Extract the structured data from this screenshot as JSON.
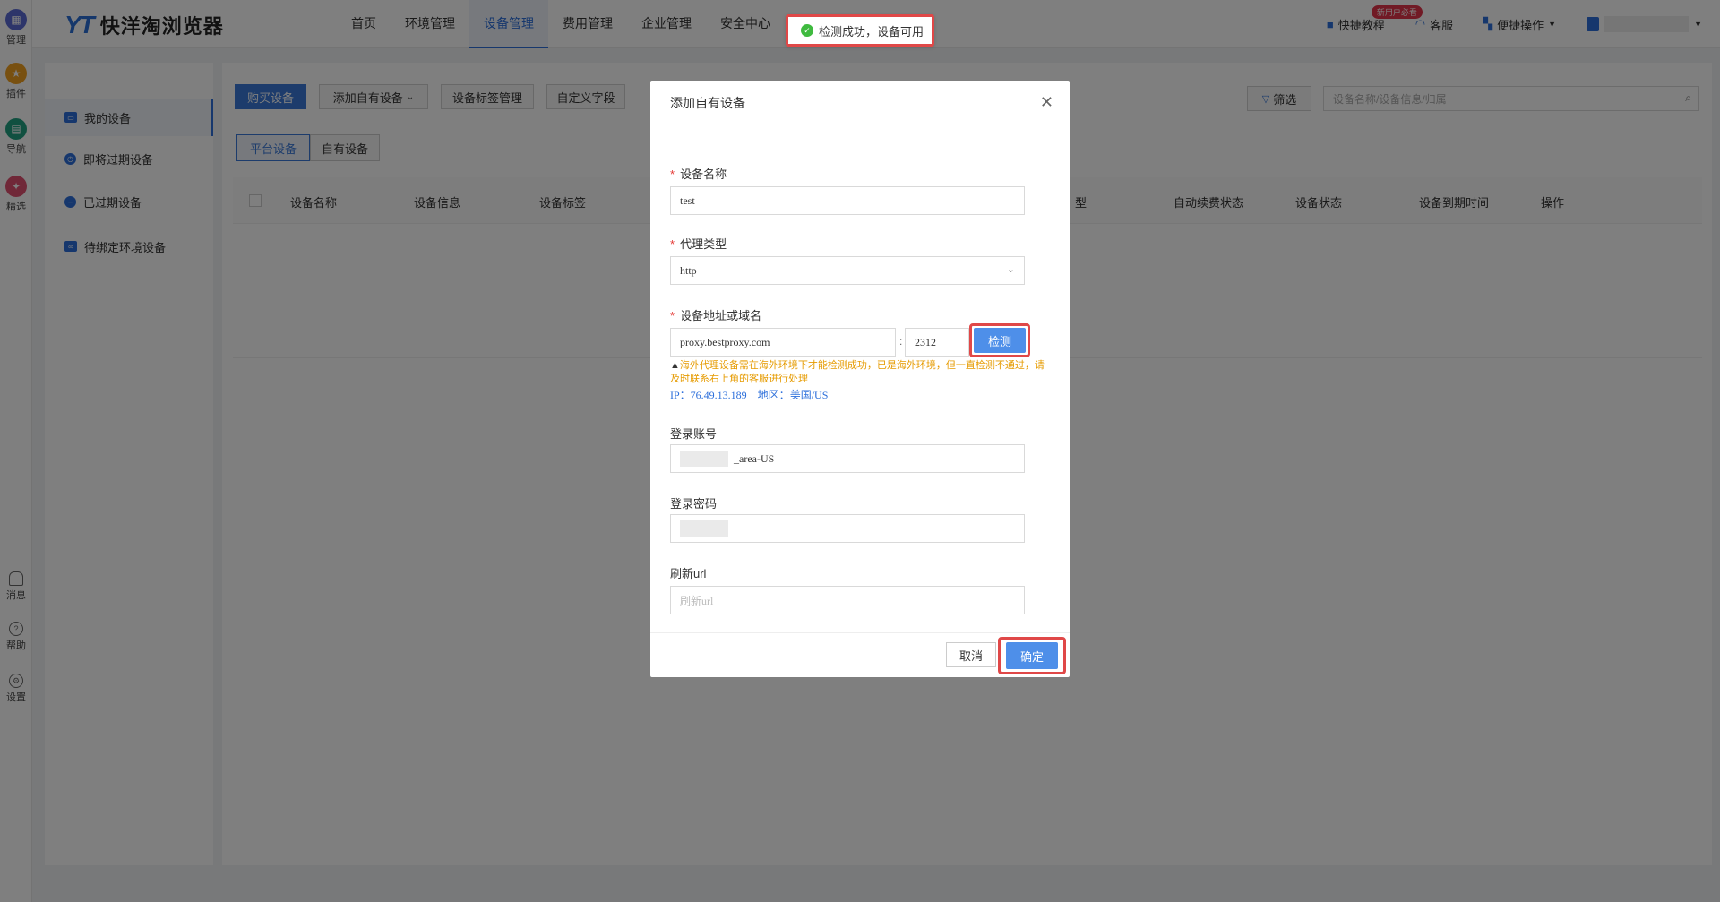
{
  "rail": {
    "items": [
      {
        "label": "管理",
        "icon": "grid-icon",
        "color": "#5b6bd4"
      },
      {
        "label": "插件",
        "icon": "star-icon",
        "color": "#f0a020"
      },
      {
        "label": "导航",
        "icon": "nav-icon",
        "color": "#20a080"
      },
      {
        "label": "精选",
        "icon": "featured-icon",
        "color": "#e05070"
      }
    ],
    "bottom": [
      {
        "label": "消息",
        "icon": "bell-icon"
      },
      {
        "label": "帮助",
        "icon": "help-icon"
      },
      {
        "label": "设置",
        "icon": "settings-icon"
      }
    ]
  },
  "header": {
    "logo_mark": "YT",
    "logo_text": "快洋淘浏览器",
    "nav": [
      "首页",
      "环境管理",
      "设备管理",
      "费用管理",
      "企业管理",
      "安全中心"
    ],
    "active_nav": "设备管理",
    "tutorial": "快捷教程",
    "tutorial_badge": "新用户必看",
    "service": "客服",
    "quick_ops": "便捷操作"
  },
  "toast": {
    "message": "检测成功，设备可用",
    "color": "#3fba3f"
  },
  "sidebar": {
    "items": [
      "我的设备",
      "即将过期设备",
      "已过期设备",
      "待绑定环境设备"
    ],
    "active": "我的设备"
  },
  "toolbar": {
    "buy": "购买设备",
    "add_own": "添加自有设备",
    "tags": "设备标签管理",
    "custom_field": "自定义字段",
    "filter": "筛选",
    "search_placeholder": "设备名称/设备信息/归属"
  },
  "subtabs": [
    "平台设备",
    "自有设备"
  ],
  "table": {
    "columns": [
      "设备名称",
      "设备信息",
      "设备标签",
      "型",
      "自动续费状态",
      "设备状态",
      "设备到期时间",
      "操作"
    ]
  },
  "modal": {
    "title": "添加自有设备",
    "name_label": "设备名称",
    "name_value": "test",
    "proxy_label": "代理类型",
    "proxy_value": "http",
    "addr_label": "设备地址或域名",
    "addr_value": "proxy.bestproxy.com",
    "port_value": "2312",
    "check_btn": "检测",
    "warning": "海外代理设备需在海外环境下才能检测成功，已是海外环境，但一直检测不通过，请及时联系右上角的客服进行处理",
    "ip_label": "IP：",
    "ip_value": "76.49.13.189",
    "region_label": "地区：",
    "region_value": "美国/US",
    "account_label": "登录账号",
    "account_suffix": "_area-US",
    "password_label": "登录密码",
    "refresh_label": "刷新url",
    "refresh_placeholder": "刷新url",
    "cancel": "取消",
    "confirm": "确定"
  }
}
